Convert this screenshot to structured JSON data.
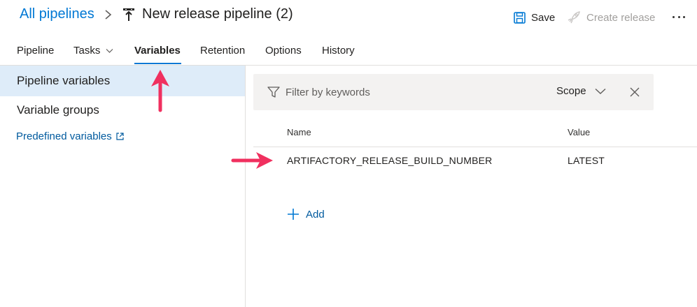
{
  "breadcrumb": {
    "root": "All pipelines",
    "title": "New release pipeline (2)"
  },
  "toolbar": {
    "save_label": "Save",
    "create_release_label": "Create release"
  },
  "tabs": [
    {
      "label": "Pipeline"
    },
    {
      "label": "Tasks"
    },
    {
      "label": "Variables",
      "active": true
    },
    {
      "label": "Retention"
    },
    {
      "label": "Options"
    },
    {
      "label": "History"
    }
  ],
  "sidebar": {
    "items": [
      {
        "label": "Pipeline variables",
        "selected": true
      },
      {
        "label": "Variable groups"
      }
    ],
    "link": "Predefined variables"
  },
  "filter": {
    "placeholder": "Filter by keywords",
    "scope_label": "Scope"
  },
  "table": {
    "columns": [
      "Name",
      "Value"
    ],
    "rows": [
      {
        "name": "ARTIFACTORY_RELEASE_BUILD_NUMBER",
        "value": "LATEST"
      }
    ]
  },
  "add_label": "Add",
  "colors": {
    "accent": "#0078d4",
    "link": "#005a9e",
    "selected_bg": "#deecf9",
    "annotation_arrow": "#f0305f"
  }
}
